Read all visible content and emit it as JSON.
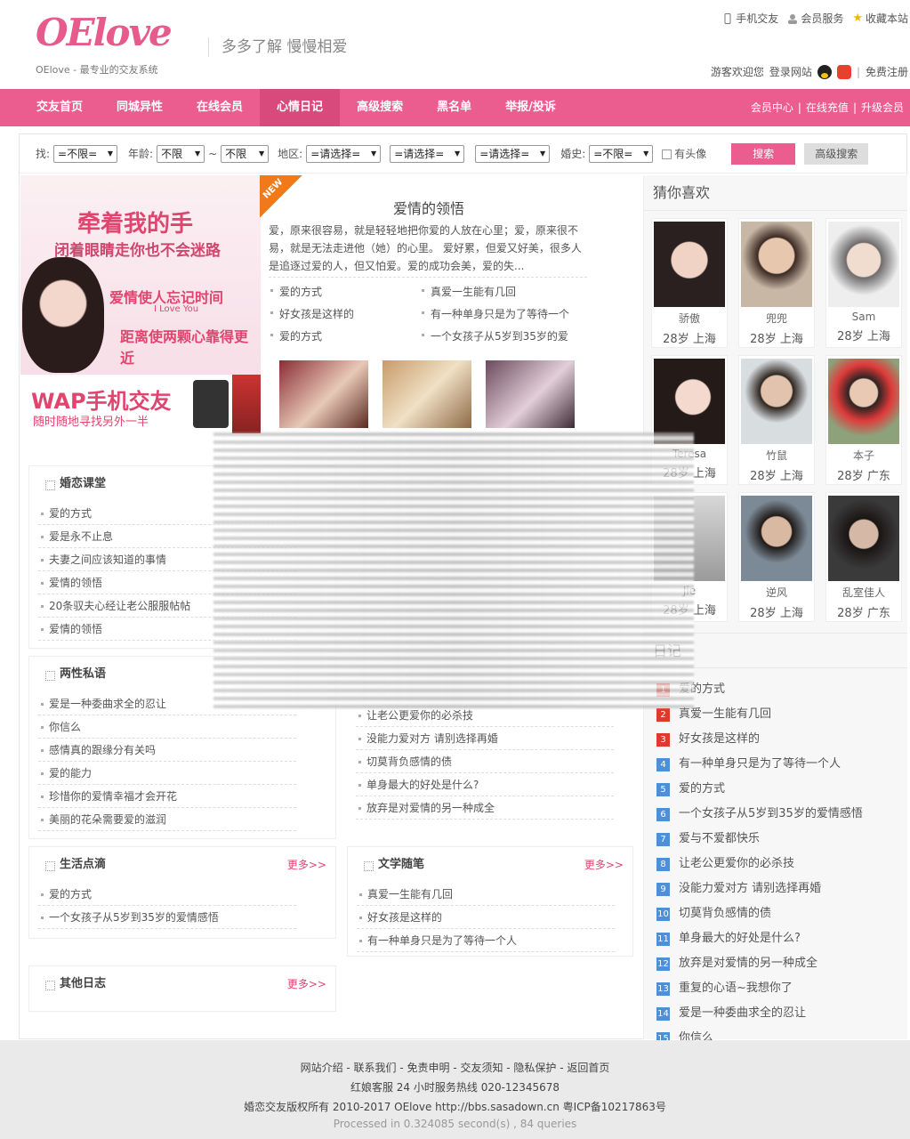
{
  "header": {
    "logo": "OElove",
    "logo_sub": "OElove - 最专业的交友系统",
    "slogan": "多多了解  慢慢相爱",
    "top_links": [
      "手机交友",
      "会员服务",
      "收藏本站"
    ],
    "welcome": "游客欢迎您",
    "login": "登录网站",
    "register": "免费注册"
  },
  "nav": {
    "items": [
      "交友首页",
      "同城异性",
      "在线会员",
      "心情日记",
      "高级搜索",
      "黑名单",
      "举报/投诉"
    ],
    "active": "心情日记",
    "right": [
      "会员中心",
      "在线充值",
      "升级会员"
    ]
  },
  "search": {
    "label_find": "找:",
    "find_value": "=不限=",
    "label_age": "年龄:",
    "age_from": "不限",
    "tilde": "~",
    "age_to": "不限",
    "label_area": "地区:",
    "area1": "=请选择=",
    "area2": "=请选择=",
    "area3": "=请选择=",
    "label_marriage": "婚史:",
    "marriage_value": "=不限=",
    "has_photo": "有头像",
    "search_btn": "搜索",
    "advanced_btn": "高级搜索"
  },
  "banner": {
    "line1": "牵着我的手",
    "line2": "闭着眼睛走你也不会迷路",
    "line3": "爱情使人忘记时间",
    "line3_en": "I Love You",
    "line4": "距离使两颗心靠得更近",
    "wap_title": "WAP手机交友",
    "wap_sub": "随时随地寻找另外一半"
  },
  "featured": {
    "new_tag": "NEW",
    "title": "爱情的领悟",
    "text": "爱，原来很容易，就是轻轻地把你爱的人放在心里；爱，原来很不易，就是无法走进他（她）的心里。    爱好累，但爱又好美，很多人是追逐过爱的人，但又怕爱。爱的成功会美，爱的失...",
    "links": [
      "爱的方式",
      "真爱一生能有几回",
      "好女孩是这样的",
      "有一种单身只是为了等待一个",
      "爱的方式",
      "一个女孩子从5岁到35岁的爱"
    ]
  },
  "guess": {
    "title": "猜你喜欢",
    "members": [
      {
        "name": "骄傲",
        "info": "28岁 上海"
      },
      {
        "name": "兜兜",
        "info": "28岁 上海"
      },
      {
        "name": "Sam",
        "info": "28岁 上海"
      },
      {
        "name": "Teresa",
        "info": "28岁 上海"
      },
      {
        "name": "竹鼠",
        "info": "28岁 上海"
      },
      {
        "name": "本子",
        "info": "28岁 广东"
      },
      {
        "name": "Jie",
        "info": "28岁 上海"
      },
      {
        "name": "逆风",
        "info": "28岁 上海"
      },
      {
        "name": "乱室佳人",
        "info": "28岁 广东"
      }
    ]
  },
  "hot_diary": {
    "title": "日记",
    "items": [
      "爱的方式",
      "真爱一生能有几回",
      "好女孩是这样的",
      "有一种单身只是为了等待一个人",
      "爱的方式",
      "一个女孩子从5岁到35岁的爱情感悟",
      "爱与不爱都快乐",
      "让老公更爱你的必杀技",
      "没能力爱对方 请别选择再婚",
      "切莫背负感情的债",
      "单身最大的好处是什么?",
      "放弃是对爱情的另一种成全",
      "重复的心语~我想你了",
      "爱是一种委曲求全的忍让",
      "你信么"
    ],
    "numbers": [
      "1",
      "2",
      "3",
      "4",
      "5",
      "6",
      "7",
      "8",
      "9",
      "10",
      "11",
      "12",
      "13",
      "14",
      "15"
    ]
  },
  "sections": {
    "more": "更多>>",
    "class": {
      "title": "婚恋课堂",
      "items": [
        "爱的方式",
        "爱是永不止息",
        "夫妻之间应该知道的事情",
        "爱情的领悟",
        "20条驭夫心经让老公服服帖帖",
        "爱情的领悟"
      ]
    },
    "whisper": {
      "title": "两性私语",
      "items": [
        "爱是一种委曲求全的忍让",
        "你信么",
        "感情真的跟缘分有关吗",
        "爱的能力",
        "珍惜你的爱情幸福才会开花",
        "美丽的花朵需要爱的滋润"
      ]
    },
    "whisper_right": {
      "items": [
        "让老公更爱你的必杀技",
        "没能力爱对方 请别选择再婚",
        "切莫背负感情的债",
        "单身最大的好处是什么?",
        "放弃是对爱情的另一种成全"
      ]
    },
    "life": {
      "title": "生活点滴",
      "items": [
        "爱的方式",
        "一个女孩子从5岁到35岁的爱情感悟"
      ]
    },
    "literature": {
      "title": "文学随笔",
      "items": [
        "真爱一生能有几回",
        "好女孩是这样的",
        "有一种单身只是为了等待一个人"
      ]
    },
    "other": {
      "title": "其他日志"
    }
  },
  "footer": {
    "links": "网站介绍 - 联系我们 - 免责申明 - 交友须知 - 隐私保护 - 返回首页",
    "service": "红娘客服      24 小时服务热线 020-12345678",
    "copyright": "婚恋交友版权所有 2010-2017 OElove http://bbs.sasadown.cn    粤ICP备10217863号",
    "processed": "Processed in 0.324085 second(s) , 84 queries"
  },
  "colors": {
    "brand": "#ea5d8e",
    "nav_active": "#d94a7c",
    "more": "#e0456f"
  }
}
